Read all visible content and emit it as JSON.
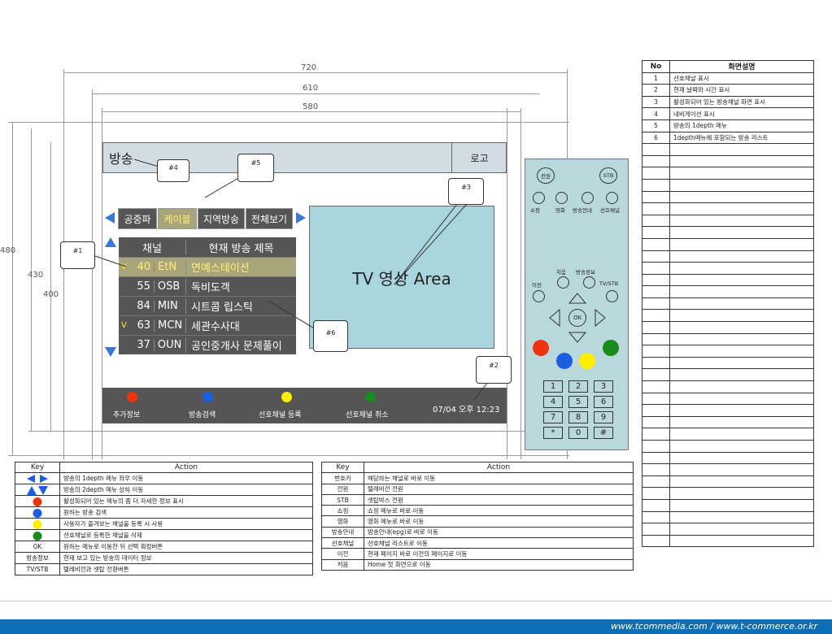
{
  "dimensions": {
    "w720": "720",
    "w610": "610",
    "w580": "580",
    "h480": "480",
    "h430": "430",
    "h400": "400"
  },
  "screen": {
    "section_title": "방송",
    "logo": "로고",
    "categories": [
      "공중파",
      "케이블",
      "지역방송",
      "전체보기"
    ],
    "table_header": {
      "channel": "채널",
      "title": "현재 방송 제목"
    },
    "channels": [
      {
        "fav": "V",
        "num": "40",
        "name": "EtN",
        "title": "연예스테이션"
      },
      {
        "fav": "",
        "num": "55",
        "name": "OSB",
        "title": "독비도객"
      },
      {
        "fav": "",
        "num": "84",
        "name": "MIN",
        "title": "시트콤 립스틱"
      },
      {
        "fav": "V",
        "num": "63",
        "name": "MCN",
        "title": "세관수사대"
      },
      {
        "fav": "",
        "num": "37",
        "name": "OUN",
        "title": "공인중개사 문제풀이"
      }
    ],
    "video_area": "TV 영상 Area",
    "bottom_labels": [
      "추가정보",
      "방송검색",
      "선호채널 등록",
      "선호채널 취소"
    ],
    "datetime": "07/04 오후 12:23",
    "callouts": [
      "#1",
      "#2",
      "#3",
      "#4",
      "#5",
      "#6"
    ]
  },
  "remote": {
    "power": "전원",
    "stb": "STB",
    "top_labels": [
      "쇼핑",
      "영화",
      "방송안내",
      "선호채널"
    ],
    "mid_labels": {
      "home": "처음",
      "info": "방송정보",
      "prev": "이전",
      "tvstb": "TV/STB"
    },
    "ok": "OK",
    "keys": [
      "1",
      "2",
      "3",
      "4",
      "5",
      "6",
      "7",
      "8",
      "9",
      "*",
      "0",
      "#"
    ]
  },
  "key_table_left": {
    "headers": [
      "Key",
      "Action"
    ],
    "rows": [
      {
        "key": "",
        "icon": "left-right-arrows-icon",
        "action": "방송의 1depth 메뉴 좌우 이동"
      },
      {
        "key": "",
        "icon": "up-down-arrows-icon",
        "action": "방송의 2depth 메뉴 상하 이동"
      },
      {
        "key": "",
        "icon": "red-circle-icon",
        "action": "활성화되어 있는 메뉴의 좀 더 자세한 정보 표시"
      },
      {
        "key": "",
        "icon": "blue-circle-icon",
        "action": "원하는 방송 검색"
      },
      {
        "key": "",
        "icon": "yellow-circle-icon",
        "action": "사용자가 즐겨보는 채널을 등록 시 사용"
      },
      {
        "key": "",
        "icon": "green-circle-icon",
        "action": "선호채널로 등록한 채널을 삭제"
      },
      {
        "key": "OK",
        "icon": "",
        "action": "원하는 메뉴로 이동한 뒤 선택 확정버튼"
      },
      {
        "key": "방송정보",
        "icon": "",
        "action": "현재 보고 있는 방송의 데이터 정보"
      },
      {
        "key": "TV/STB",
        "icon": "",
        "action": "텔레비전과 셋탑 전환버튼"
      }
    ]
  },
  "key_table_right": {
    "headers": [
      "Key",
      "Action"
    ],
    "rows": [
      {
        "key": "번호키",
        "action": "해당하는 채널로 바로 이동"
      },
      {
        "key": "전원",
        "action": "텔레비전 전원"
      },
      {
        "key": "STB",
        "action": "셋탑박스 전원"
      },
      {
        "key": "쇼핑",
        "action": "쇼핑 메뉴로 바로 이동"
      },
      {
        "key": "영화",
        "action": "영화 메뉴로 바로 이동"
      },
      {
        "key": "방송안내",
        "action": "방송안내(epg)로 바로 이동"
      },
      {
        "key": "선호채널",
        "action": "선호채널 리스트로 이동"
      },
      {
        "key": "이전",
        "action": "현재 페이지 바로 이전의 페이지로 이동"
      },
      {
        "key": "처음",
        "action": "Home 첫 화면으로 이동"
      }
    ]
  },
  "desc_table": {
    "headers": [
      "No",
      "화면설명"
    ],
    "rows": [
      {
        "no": "1",
        "desc": "선호채널 표시"
      },
      {
        "no": "2",
        "desc": "현재 날짜와 시간 표시"
      },
      {
        "no": "3",
        "desc": "활성화되어 있는 방송채널 화면 표시"
      },
      {
        "no": "4",
        "desc": "네비게이션 표시"
      },
      {
        "no": "5",
        "desc": "방송의 1depth 메뉴"
      },
      {
        "no": "6",
        "desc": "1depth메뉴에 포함되는 방송 리스트"
      }
    ],
    "empty_rows": 34
  },
  "footer": {
    "url": "www.tcommedia.com / www.t-commerce.or.kr"
  },
  "colors": {
    "red": "#ee3311",
    "blue": "#1a5fe0",
    "yellow": "#ffee00",
    "green": "#1a8a1a",
    "accent": "#3a78d8",
    "footer": "#0a6fb8"
  }
}
